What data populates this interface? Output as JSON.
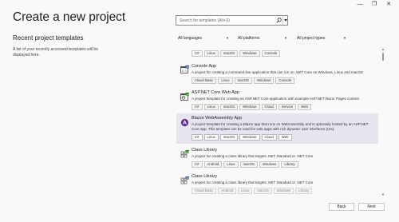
{
  "window": {
    "minimize_glyph": "—",
    "maximize_glyph": "❐",
    "close_glyph": "✕"
  },
  "page_title": "Create a new project",
  "recent": {
    "heading": "Recent project templates",
    "empty_text": "A list of your recently accessed templates will be displayed here."
  },
  "search": {
    "placeholder": "Search for templates (Alt+S)",
    "value": ""
  },
  "filters": {
    "language": "All languages",
    "platform": "All platforms",
    "project_type": "All project types"
  },
  "templates": [
    {
      "name": "",
      "description": "",
      "tags": [
        "C#",
        "Linux",
        "macOS",
        "Windows",
        "Console"
      ],
      "icon": "console-icon"
    },
    {
      "name": "Console App",
      "description": "A project for creating a command-line application that can run on .NET Core on Windows, Linux and macOS",
      "tags": [
        "Visual Basic",
        "Linux",
        "macOS",
        "Windows",
        "Console"
      ],
      "icon": "console-icon"
    },
    {
      "name": "ASP.NET Core Web App",
      "description": "A project template for creating an ASP.NET Core application with example ASP.NET Razor Pages content.",
      "tags": [
        "C#",
        "Linux",
        "macOS",
        "Windows",
        "Cloud",
        "Service",
        "Web"
      ],
      "icon": "web-app-icon"
    },
    {
      "name": "Blazor WebAssembly App",
      "description": "A project template for creating a Blazor app that runs on WebAssembly and is optionally hosted by an ASP.NET Core app. This template can be used for web apps with rich dynamic user interfaces (UIs).",
      "tags": [
        "C#",
        "Linux",
        "macOS",
        "Windows",
        "Cloud",
        "Web"
      ],
      "icon": "blazor-icon"
    },
    {
      "name": "Class Library",
      "description": "A project for creating a class library that targets .NET Standard or .NET Core",
      "tags": [
        "C#",
        "Android",
        "Linux",
        "macOS",
        "Windows",
        "Library"
      ],
      "icon": "class-library-icon"
    },
    {
      "name": "Class Library",
      "description": "A project for creating a class library that targets .NET Standard or .NET Core",
      "tags": [
        "Visual Basic",
        "Android",
        "Linux",
        "macOS",
        "Windows",
        "Library"
      ],
      "icon": "class-library-icon"
    }
  ],
  "buttons": {
    "back": "Back",
    "next": "Next"
  },
  "colors": {
    "selected_row": "#e5e5ef",
    "blazor_purple": "#5c2d91",
    "page_bg": "#f9f9f9"
  }
}
